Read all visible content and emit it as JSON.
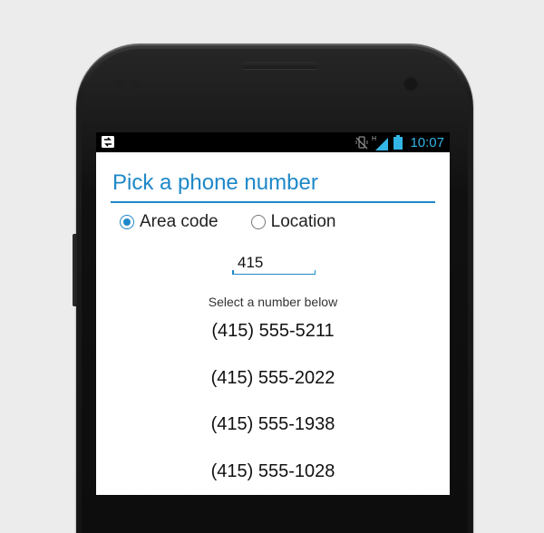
{
  "status_bar": {
    "time": "10:07",
    "icons": [
      "app-notification-icon",
      "vibrate-icon",
      "signal-h-icon",
      "battery-icon"
    ],
    "network_label": "H"
  },
  "screen": {
    "title": "Pick a phone number",
    "radio_options": [
      {
        "label": "Area code",
        "selected": true
      },
      {
        "label": "Location",
        "selected": false
      }
    ],
    "area_code_input": {
      "value": "415"
    },
    "hint": "Select a number below",
    "phone_numbers": [
      "(415) 555-5211",
      "(415) 555-2022",
      "(415) 555-1938",
      "(415) 555-1028"
    ]
  },
  "colors": {
    "accent": "#1e88c8",
    "status_accent": "#33b5e5",
    "background": "#ececec"
  }
}
